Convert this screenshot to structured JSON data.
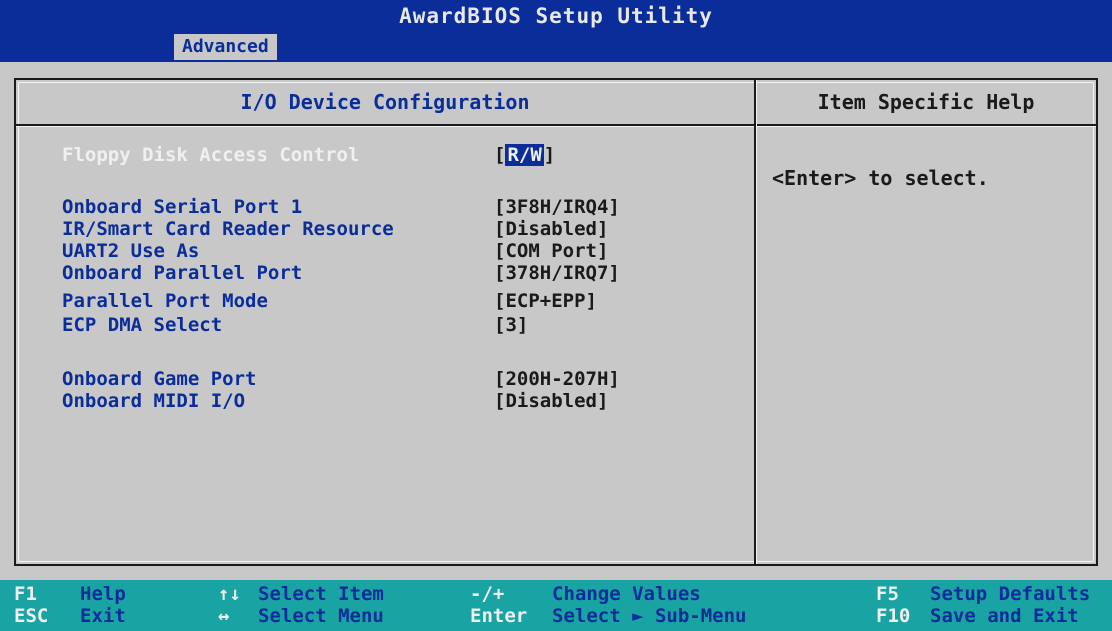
{
  "title": "AwardBIOS Setup Utility",
  "menu": {
    "active_tab": "Advanced"
  },
  "section_title": "I/O Device Configuration",
  "help": {
    "title": "Item Specific Help",
    "text": "<Enter> to select."
  },
  "settings": [
    {
      "label": "Floppy Disk Access Control",
      "value_open": "[",
      "value": "R/W",
      "value_close": "]",
      "selected": true
    },
    {
      "label": "Onboard Serial Port 1",
      "value": "[3F8H/IRQ4]"
    },
    {
      "label": "IR/Smart Card Reader Resource",
      "value": "[Disabled]"
    },
    {
      "label": "UART2 Use As",
      "value": "[COM Port]"
    },
    {
      "label": "Onboard Parallel Port",
      "value": "[378H/IRQ7]"
    },
    {
      "label": "Parallel Port Mode",
      "value": "[ECP+EPP]"
    },
    {
      "label": "ECP DMA Select",
      "value": "[3]"
    },
    {
      "label": "Onboard Game Port",
      "value": "[200H-207H]"
    },
    {
      "label": "Onboard MIDI I/O",
      "value": "[Disabled]"
    }
  ],
  "keys": [
    {
      "code": "F1",
      "desc": "Help"
    },
    {
      "code": "ESC",
      "desc": "Exit"
    },
    {
      "code": "↑↓",
      "desc": "Select Item"
    },
    {
      "code": "↔",
      "desc": "Select Menu"
    },
    {
      "code": "-/+",
      "desc": "Change Values"
    },
    {
      "code": "Enter",
      "desc": "Select ► Sub-Menu"
    },
    {
      "code": "F5",
      "desc": "Setup Defaults"
    },
    {
      "code": "F10",
      "desc": "Save and Exit"
    }
  ],
  "colors": {
    "bios_blue": "#0a2d9a",
    "panel_gray": "#c8c8c8",
    "key_bar_cyan": "#1aa3a3",
    "highlight_white": "#f0f0f0"
  }
}
